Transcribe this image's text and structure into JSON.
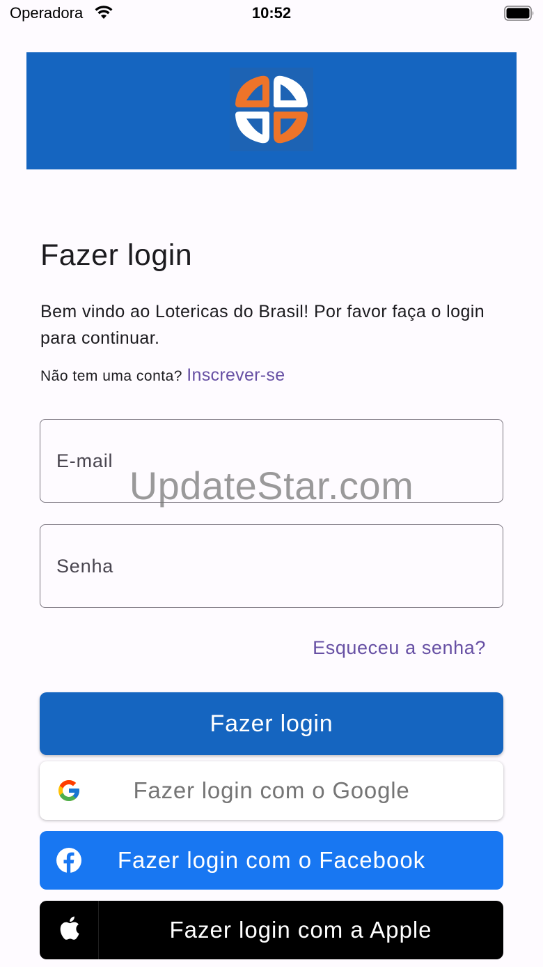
{
  "status_bar": {
    "carrier": "Operadora",
    "time": "10:52",
    "icons": [
      "wifi-icon",
      "battery-icon"
    ]
  },
  "banner": {
    "logo_icon": "loterica-clover-logo-icon",
    "colors": {
      "background": "#1565c0",
      "orange": "#ee7429",
      "white": "#ffffff"
    }
  },
  "login": {
    "title": "Fazer login",
    "welcome": "Bem vindo ao Lotericas do Brasil! Por favor faça o login para continuar.",
    "no_account": "Não tem uma conta?",
    "signup_link": "Inscrever-se",
    "email_placeholder": "E-mail",
    "password_placeholder": "Senha",
    "forgot_password": "Esqueceu a senha?",
    "login_button": "Fazer login",
    "google_button": "Fazer login com o Google",
    "facebook_button": "Fazer login com o Facebook",
    "apple_button": "Fazer login com a Apple"
  },
  "watermark": "UpdateStar.com",
  "colors": {
    "primary": "#1565c0",
    "link": "#6750a4",
    "facebook": "#1877f2",
    "apple": "#000000"
  }
}
